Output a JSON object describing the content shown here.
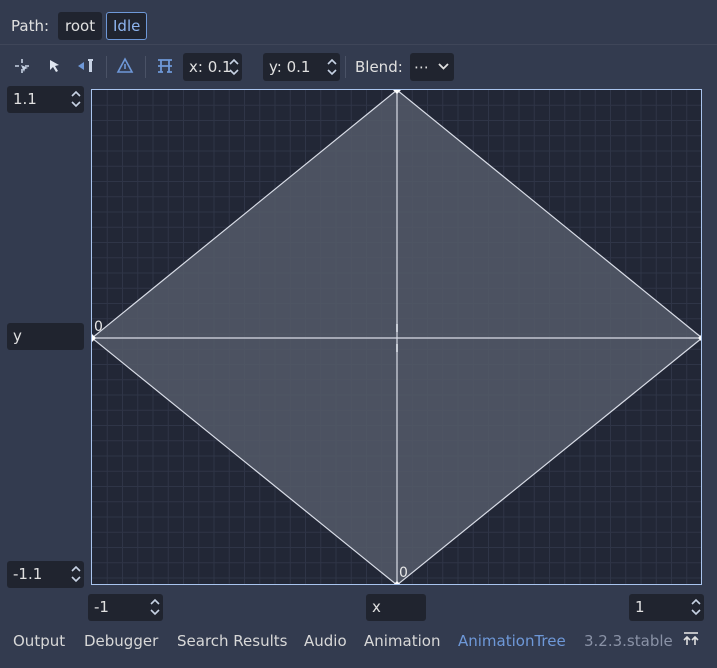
{
  "path_bar": {
    "label": "Path:",
    "crumbs": [
      "root",
      "Idle"
    ]
  },
  "toolbar": {
    "tool_icons": [
      "select-points-icon",
      "create-points-icon",
      "erase-point-icon",
      "create-triangles-icon",
      "snap-icon"
    ],
    "snap_x": "x: 0.1",
    "snap_y": "y: 0.1",
    "blend_label": "Blend:",
    "blend_value": "⋯"
  },
  "blend_space": {
    "y_max": "1.1",
    "y_min": "-1.1",
    "y_label": "y",
    "x_min": "-1",
    "x_max": "1",
    "x_label": "x",
    "point_labels": [
      "0",
      "0"
    ]
  },
  "bottom_panel": {
    "tabs": [
      "Output",
      "Debugger",
      "Search Results",
      "Audio",
      "Animation",
      "AnimationTree"
    ],
    "active_tab": "AnimationTree",
    "version": "3.2.3.stable"
  },
  "colors": {
    "background": "#333b4f",
    "field": "#20242f",
    "accent": "#6e98d8",
    "canvas": "#222736"
  }
}
